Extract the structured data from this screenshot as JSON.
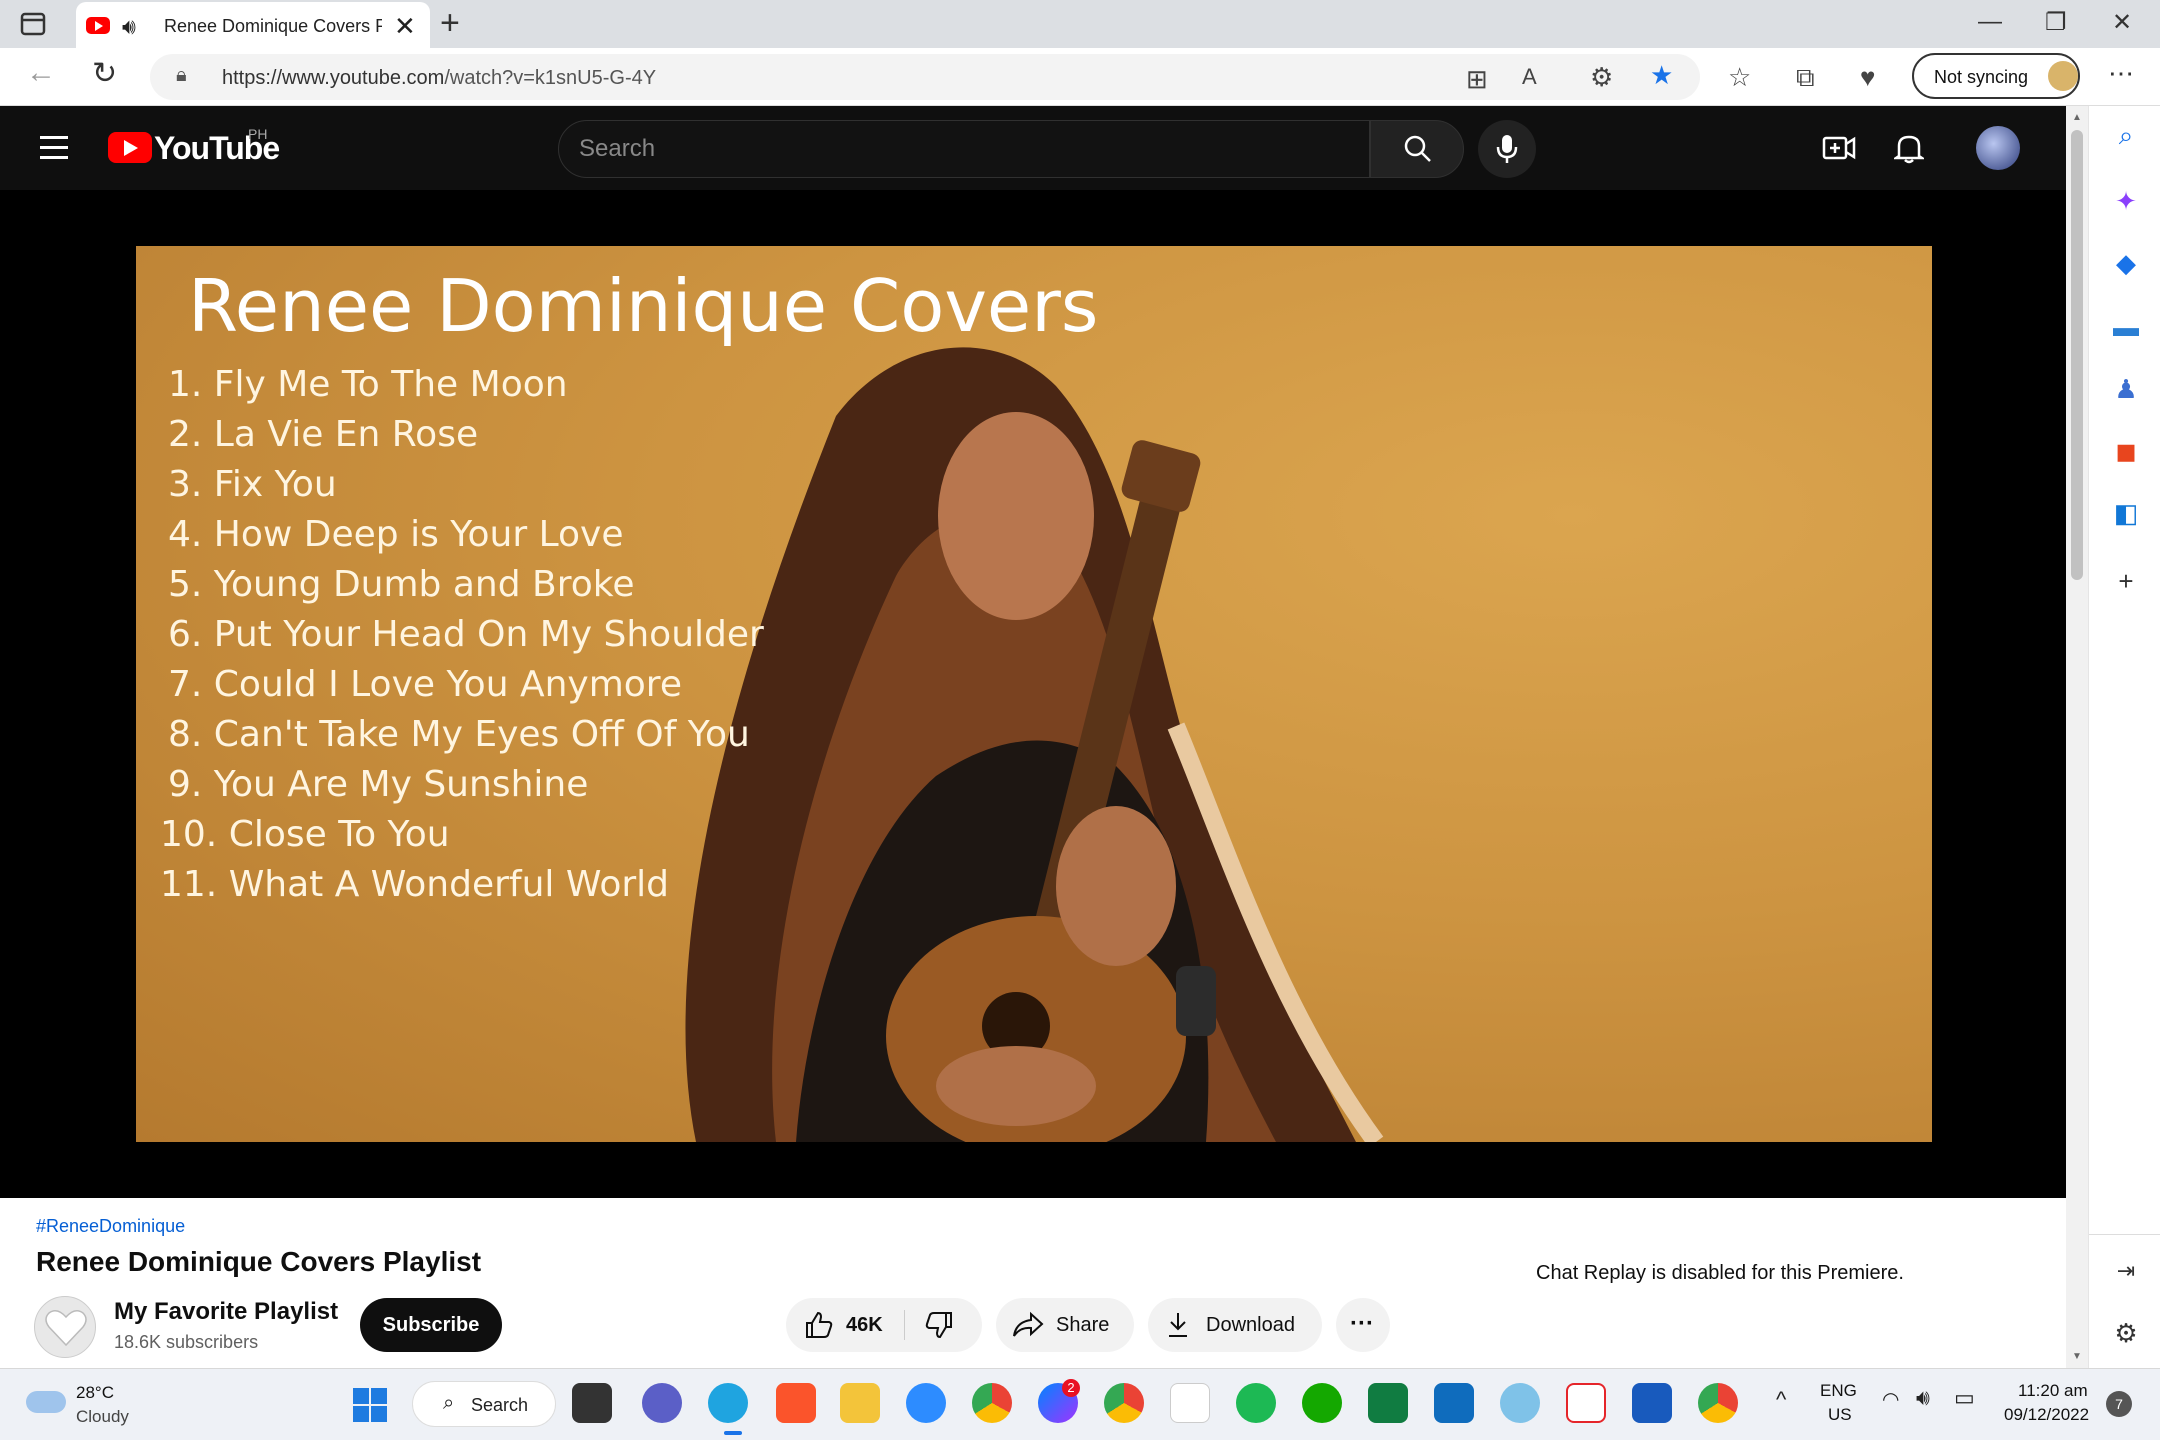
{
  "browser": {
    "tab_title": "Renee Dominique Covers Pl",
    "tab_close": "✕",
    "new_tab": "+",
    "url_host": "https://www.youtube.com",
    "url_path": "/watch?v=k1snU5-G-4Y",
    "sync_label": "Not syncing",
    "window_controls": [
      "—",
      "❐",
      "✕"
    ]
  },
  "youtube": {
    "logo_text": "YouTube",
    "country": "PH",
    "search_placeholder": "Search"
  },
  "thumbnail": {
    "title": "Renee Dominique Covers",
    "tracks": [
      "1.  Fly Me To The Moon",
      "2.  La Vie En Rose",
      "3.  Fix You",
      "4.  How Deep is Your Love",
      "5.  Young Dumb and Broke",
      "6.  Put Your Head On My Shoulder",
      "7.  Could I Love You Anymore",
      "8. Can't Take My Eyes Off Of You",
      "9.  You Are My Sunshine",
      "10. Close To You",
      "11. What A Wonderful World"
    ]
  },
  "video": {
    "hashtag": "#ReneeDominique",
    "title": "Renee Dominique Covers Playlist",
    "channel_name": "My Favorite Playlist",
    "subscribers": "18.6K subscribers",
    "subscribe_label": "Subscribe",
    "likes": "46K",
    "share_label": "Share",
    "download_label": "Download",
    "more": "···",
    "chat_note": "Chat Replay is disabled for this Premiere."
  },
  "taskbar": {
    "temperature": "28°C",
    "weather": "Cloudy",
    "search_label": "Search",
    "lang_top": "ENG",
    "lang_bottom": "US",
    "time": "11:20 am",
    "date": "09/12/2022",
    "notif_count": "7",
    "messenger_badge": "2"
  },
  "colors": {
    "youtube_red": "#ff0000",
    "yt_header_bg": "#0f0f0f",
    "link_blue": "#065fd4",
    "thumb_orange": "#cd9441"
  }
}
